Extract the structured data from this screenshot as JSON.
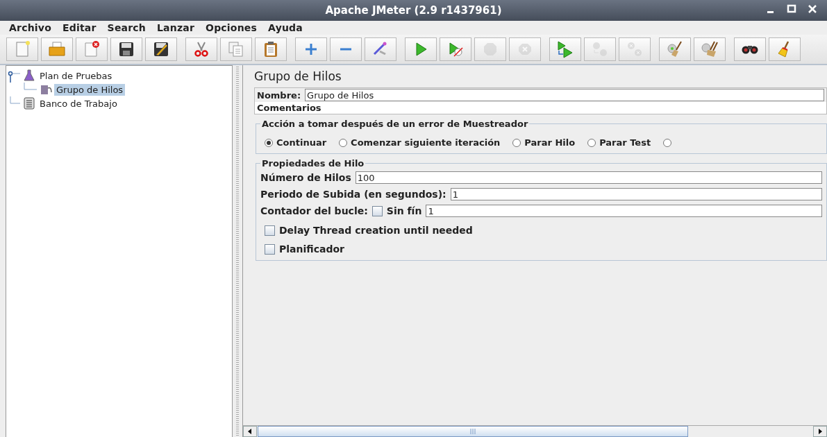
{
  "window": {
    "title": "Apache JMeter (2.9 r1437961)"
  },
  "menu": [
    "Archivo",
    "Editar",
    "Search",
    "Lanzar",
    "Opciones",
    "Ayuda"
  ],
  "toolbar": [
    [
      {
        "disabled": false
      },
      {
        "disabled": false
      },
      {
        "disabled": false
      },
      {
        "disabled": false
      },
      {
        "disabled": false
      }
    ],
    [
      {
        "disabled": false
      },
      {
        "disabled": false
      },
      {
        "disabled": false
      }
    ],
    [
      {
        "disabled": false
      },
      {
        "disabled": false
      },
      {
        "disabled": false
      }
    ],
    [
      {
        "disabled": false
      },
      {
        "disabled": false
      },
      {
        "disabled": true
      },
      {
        "disabled": true
      }
    ],
    [
      {
        "disabled": false
      },
      {
        "disabled": true
      },
      {
        "disabled": true
      }
    ],
    [
      {
        "disabled": false
      },
      {
        "disabled": false
      }
    ],
    [
      {
        "disabled": false
      },
      {
        "disabled": false
      }
    ]
  ],
  "tree": [
    {
      "label": "Plan de Pruebas",
      "kind": "plan",
      "expanded": true,
      "selected": false,
      "children": [
        {
          "label": "Grupo de Hilos",
          "kind": "threads",
          "selected": true
        }
      ]
    },
    {
      "label": "Banco de Trabajo",
      "kind": "workbench",
      "selected": false
    }
  ],
  "panel": {
    "title": "Grupo de Hilos",
    "name_label": "Nombre:",
    "name_value": "Grupo de Hilos",
    "comments_label": "Comentarios",
    "error_action": {
      "legend": "Acción a tomar después de un error de Muestreador",
      "options": [
        {
          "label": "Continuar",
          "selected": true
        },
        {
          "label": "Comenzar siguiente iteración",
          "selected": false
        },
        {
          "label": "Parar Hilo",
          "selected": false
        },
        {
          "label": "Parar Test",
          "selected": false
        },
        {
          "selected": false
        }
      ]
    },
    "properties": {
      "legend": "Propiedades de Hilo",
      "threads_label": "Número de Hilos",
      "threads_value": "100",
      "rampup_label": "Periodo de Subida (en segundos):",
      "rampup_value": "1",
      "loop_label": "Contador del bucle:",
      "forever_label": "Sin fín",
      "forever_checked": false,
      "loop_value": "1",
      "checkboxes": [
        {
          "label": "Delay Thread creation until needed",
          "checked": false
        },
        {
          "label": "Planificador",
          "checked": false
        }
      ]
    }
  }
}
